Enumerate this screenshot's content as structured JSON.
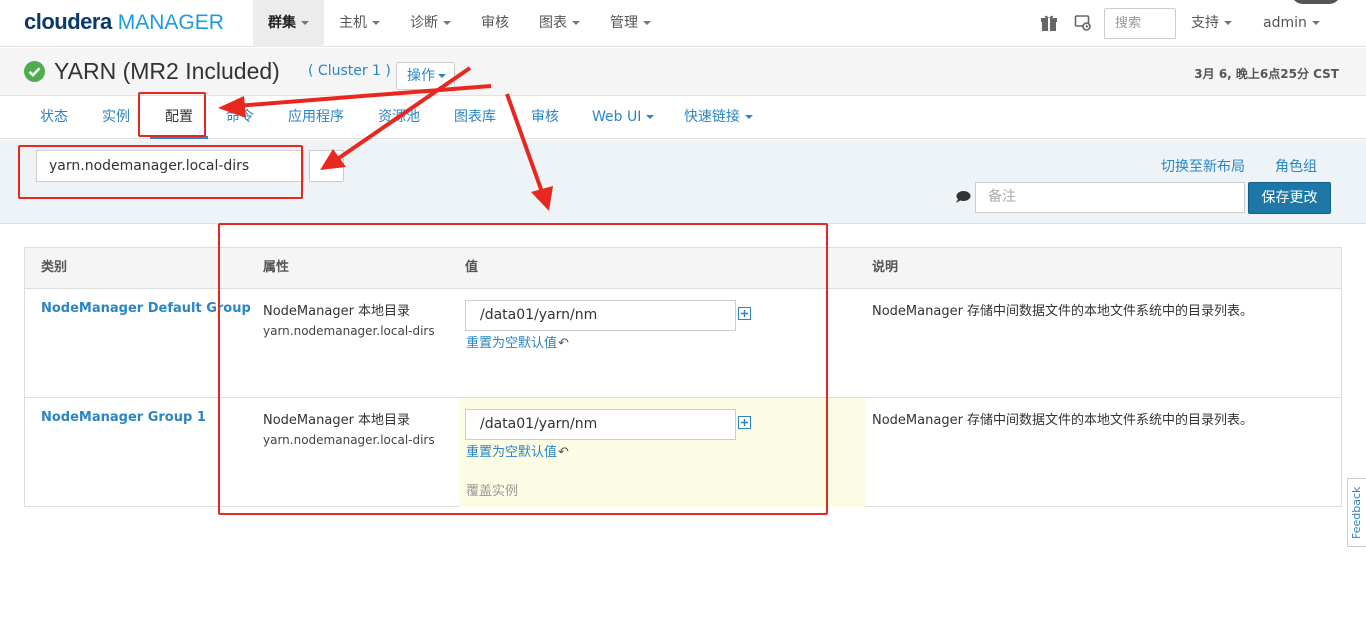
{
  "topbar": {
    "logo_brand": "cloudera",
    "logo_product": "MANAGER",
    "nav": [
      "群集",
      "主机",
      "诊断",
      "审核",
      "图表",
      "管理"
    ],
    "nav_with_caret": [
      true,
      true,
      true,
      false,
      true,
      true
    ],
    "search_placeholder": "搜索",
    "support_label": "支持",
    "user_label": "admin"
  },
  "service": {
    "title": "YARN (MR2 Included)",
    "cluster": "( Cluster 1 )",
    "actions_label": "操作",
    "timestamp": "3月 6, 晚上6点25分 CST",
    "status_color": "#4cae4c"
  },
  "tabs": [
    "状态",
    "实例",
    "配置",
    "命令",
    "应用程序",
    "资源池",
    "图表库",
    "审核",
    "Web UI",
    "快速链接"
  ],
  "active_tab": "配置",
  "filter": {
    "search_value": "yarn.nodemanager.local-dirs",
    "switch_layout": "切换至新布局",
    "role_groups": "角色组",
    "note_placeholder": "备注",
    "save_label": "保存更改"
  },
  "table": {
    "headers": {
      "category": "类别",
      "property": "属性",
      "value": "值",
      "description": "说明"
    },
    "rows": [
      {
        "group": "NodeManager Default Group",
        "property_name": "NodeManager 本地目录",
        "property_key": "yarn.nodemanager.local-dirs",
        "value": "/data01/yarn/nm",
        "reset_label": "重置为空默认值",
        "description": "NodeManager 存储中间数据文件的本地文件系统中的目录列表。"
      },
      {
        "group": "NodeManager Group 1",
        "property_name": "NodeManager 本地目录",
        "property_key": "yarn.nodemanager.local-dirs",
        "value": "/data01/yarn/nm",
        "reset_label": "重置为空默认值",
        "override_label": "覆盖实例",
        "description": "NodeManager 存储中间数据文件的本地文件系统中的目录列表。"
      }
    ]
  },
  "feedback_label": "Feedback",
  "colors": {
    "accent": "#2a85c5",
    "primary_button": "#1d78a8",
    "annotation": "#e8281f",
    "override_bg": "#fcfbe3"
  }
}
